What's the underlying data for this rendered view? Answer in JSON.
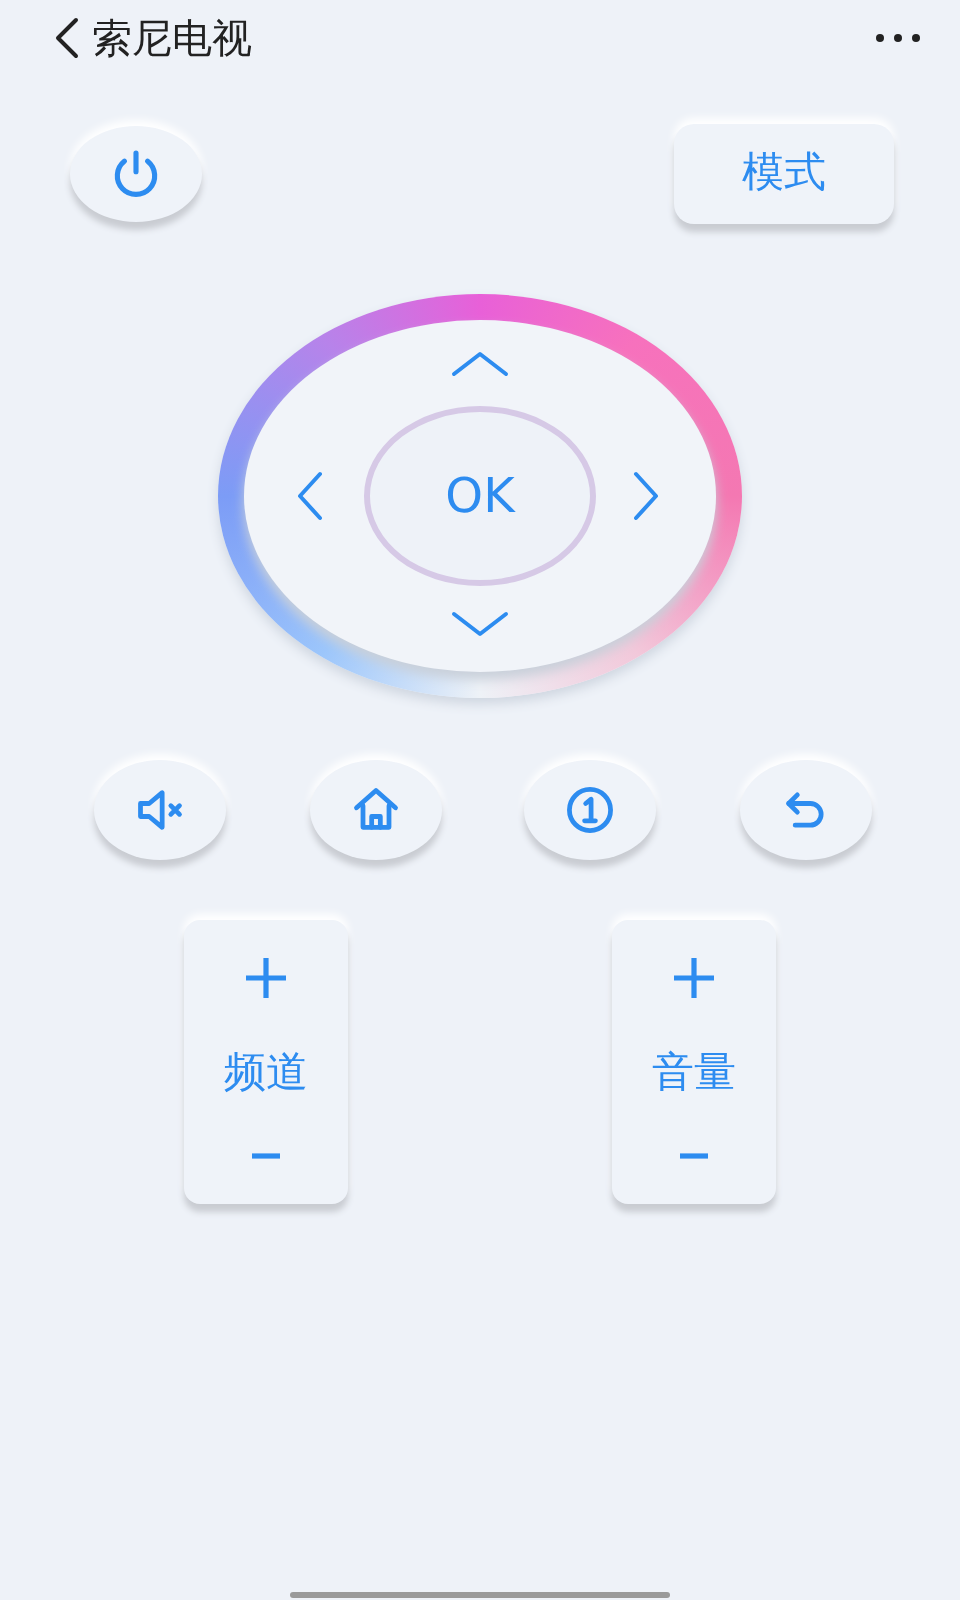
{
  "header": {
    "title": "索尼电视"
  },
  "mode_button": {
    "label": "模式"
  },
  "dpad": {
    "ok_label": "OK"
  },
  "function_buttons": [
    {
      "kind": "mute"
    },
    {
      "kind": "home"
    },
    {
      "kind": "one"
    },
    {
      "kind": "back"
    }
  ],
  "rockers": [
    {
      "label": "频道"
    },
    {
      "label": "音量"
    }
  ]
}
